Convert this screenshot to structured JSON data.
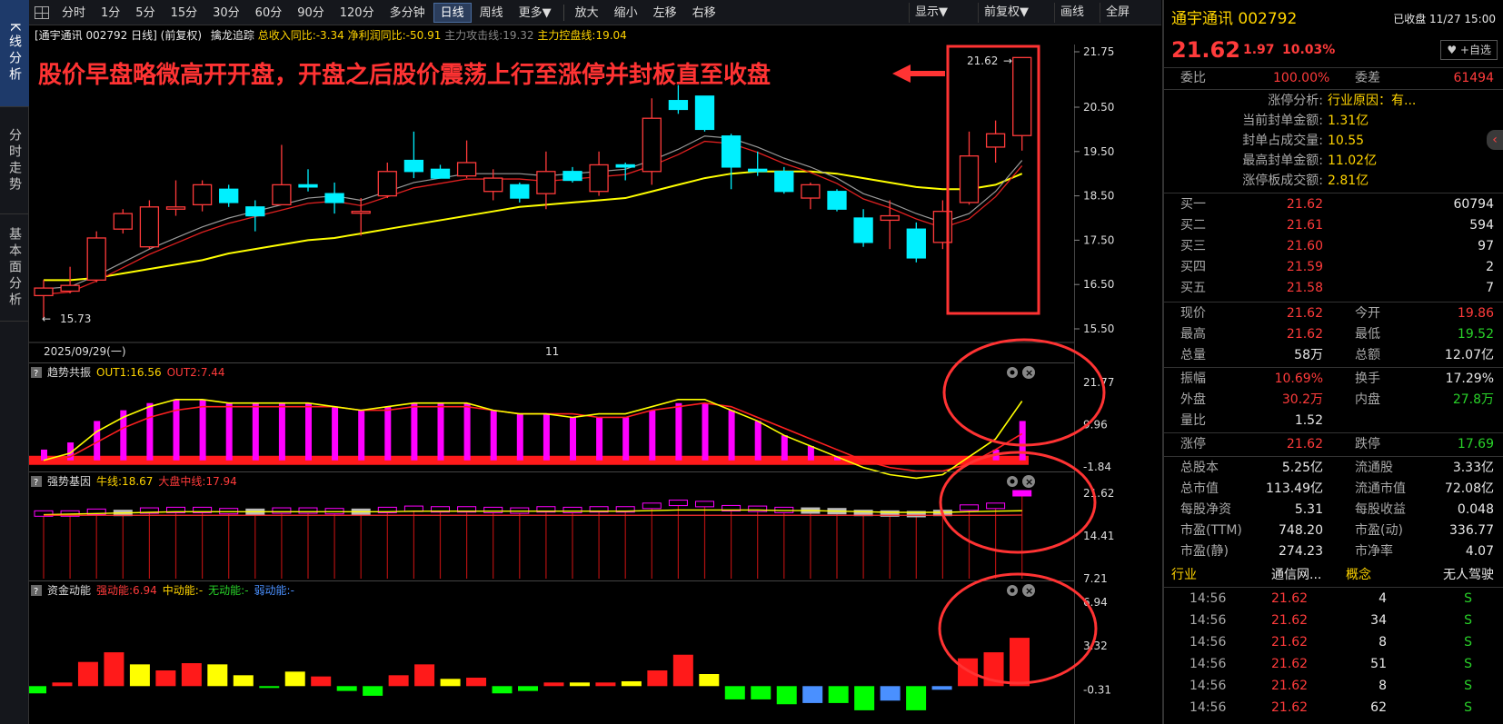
{
  "rail": {
    "tabs": [
      {
        "label": "K线分析",
        "active": true
      },
      {
        "label": "分时走势",
        "active": false
      },
      {
        "label": "基本面分析",
        "active": false
      }
    ]
  },
  "toolbar": {
    "periods": [
      "分时",
      "1分",
      "5分",
      "15分",
      "30分",
      "60分",
      "90分",
      "120分",
      "多分钟",
      "日线",
      "周线",
      "更多▼"
    ],
    "active_period": "日线",
    "actions": [
      "放大",
      "缩小",
      "左移",
      "右移"
    ],
    "right": [
      "显示▼",
      "前复权▼",
      "画线",
      "全屏"
    ]
  },
  "infobar": {
    "stock": "[通宇通讯 002792 日线]",
    "adjust": "(前复权)",
    "indicator": "擒龙追踪",
    "rev": "总收入同比:-3.34",
    "profit": "净利润同比:-50.91",
    "attack": "主力攻击线:19.32",
    "control": "主力控盘线:19.04"
  },
  "annotation": "股价早盘略微高开开盘，开盘之后股价震荡上行至涨停并封板直至收盘",
  "main_chart": {
    "price_axis": [
      "21.75",
      "20.50",
      "19.50",
      "18.50",
      "17.50",
      "16.50",
      "15.50"
    ],
    "date_left": "2025/09/29(一)",
    "date_mid": "11",
    "low_label": "15.73",
    "high_label": "21.62"
  },
  "panel1": {
    "name": "趋势共振",
    "out1": "OUT1:16.56",
    "out2": "OUT2:7.44",
    "axis": [
      "21.77",
      "9.96",
      "-1.84"
    ]
  },
  "panel2": {
    "name": "强势基因",
    "bull": "牛线:18.67",
    "market": "大盘中线:17.94",
    "axis": [
      "21.62",
      "14.41",
      "7.21"
    ]
  },
  "panel3": {
    "name": "资金动能",
    "strong": "强动能:6.94",
    "mid": "中动能:-",
    "none": "无动能:-",
    "weak": "弱动能:-",
    "axis": [
      "6.94",
      "3.32",
      "-0.31"
    ]
  },
  "chart_data": [
    {
      "type": "candlestick",
      "title": "通宇通讯 002792 日线",
      "candles": [
        {
          "o": 16.25,
          "c": 16.42,
          "h": 16.6,
          "l": 15.73
        },
        {
          "o": 16.35,
          "c": 16.48,
          "h": 16.9,
          "l": 16.3
        },
        {
          "o": 16.6,
          "c": 17.55,
          "h": 17.7,
          "l": 16.55
        },
        {
          "o": 17.75,
          "c": 18.1,
          "h": 18.2,
          "l": 17.65
        },
        {
          "o": 17.35,
          "c": 18.25,
          "h": 18.4,
          "l": 17.3
        },
        {
          "o": 18.2,
          "c": 18.25,
          "h": 18.85,
          "l": 18.05
        },
        {
          "o": 18.3,
          "c": 18.75,
          "h": 18.85,
          "l": 18.15
        },
        {
          "o": 18.65,
          "c": 18.35,
          "h": 18.75,
          "l": 18.25
        },
        {
          "o": 18.25,
          "c": 18.05,
          "h": 18.4,
          "l": 17.7
        },
        {
          "o": 18.3,
          "c": 18.75,
          "h": 19.65,
          "l": 18.3
        },
        {
          "o": 18.75,
          "c": 18.7,
          "h": 19.1,
          "l": 18.6
        },
        {
          "o": 18.55,
          "c": 18.35,
          "h": 18.8,
          "l": 18.1
        },
        {
          "o": 18.15,
          "c": 18.15,
          "h": 18.45,
          "l": 17.6
        },
        {
          "o": 18.5,
          "c": 19.05,
          "h": 19.25,
          "l": 18.45
        },
        {
          "o": 19.3,
          "c": 19.05,
          "h": 19.95,
          "l": 18.9
        },
        {
          "o": 19.1,
          "c": 18.9,
          "h": 19.2,
          "l": 18.9
        },
        {
          "o": 18.95,
          "c": 19.25,
          "h": 19.75,
          "l": 18.9
        },
        {
          "o": 18.6,
          "c": 18.9,
          "h": 19.1,
          "l": 18.4
        },
        {
          "o": 18.75,
          "c": 18.45,
          "h": 18.8,
          "l": 18.35
        },
        {
          "o": 18.55,
          "c": 19.05,
          "h": 19.5,
          "l": 18.2
        },
        {
          "o": 19.05,
          "c": 18.85,
          "h": 19.15,
          "l": 18.8
        },
        {
          "o": 18.6,
          "c": 19.2,
          "h": 19.5,
          "l": 18.5
        },
        {
          "o": 19.2,
          "c": 19.15,
          "h": 19.25,
          "l": 18.85
        },
        {
          "o": 19.05,
          "c": 20.25,
          "h": 20.7,
          "l": 18.75
        },
        {
          "o": 20.65,
          "c": 20.45,
          "h": 21.0,
          "l": 20.35
        },
        {
          "o": 20.75,
          "c": 20.0,
          "h": 20.75,
          "l": 19.95
        },
        {
          "o": 19.85,
          "c": 19.15,
          "h": 19.9,
          "l": 18.65
        },
        {
          "o": 19.1,
          "c": 19.05,
          "h": 19.5,
          "l": 18.95
        },
        {
          "o": 19.05,
          "c": 18.6,
          "h": 19.15,
          "l": 18.55
        },
        {
          "o": 18.45,
          "c": 18.75,
          "h": 18.8,
          "l": 18.2
        },
        {
          "o": 18.6,
          "c": 18.2,
          "h": 18.65,
          "l": 18.15
        },
        {
          "o": 18.0,
          "c": 17.45,
          "h": 18.2,
          "l": 17.35
        },
        {
          "o": 17.95,
          "c": 18.05,
          "h": 18.4,
          "l": 17.3
        },
        {
          "o": 17.75,
          "c": 17.1,
          "h": 17.9,
          "l": 17.0
        },
        {
          "o": 17.45,
          "c": 18.15,
          "h": 18.4,
          "l": 17.3
        },
        {
          "o": 18.35,
          "c": 19.4,
          "h": 19.95,
          "l": 18.3
        },
        {
          "o": 19.6,
          "c": 19.9,
          "h": 20.2,
          "l": 19.25
        },
        {
          "o": 19.86,
          "c": 21.62,
          "h": 21.62,
          "l": 19.52
        }
      ],
      "ma_white": [
        16.4,
        16.45,
        16.7,
        17.0,
        17.3,
        17.55,
        17.8,
        18.0,
        18.15,
        18.3,
        18.45,
        18.5,
        18.4,
        18.6,
        18.8,
        18.9,
        19.0,
        19.0,
        19.0,
        18.95,
        19.0,
        19.05,
        19.1,
        19.3,
        19.55,
        19.85,
        19.8,
        19.6,
        19.35,
        19.15,
        18.9,
        18.55,
        18.35,
        18.1,
        17.9,
        18.1,
        18.6,
        19.3
      ],
      "ma_yellow": [
        16.6,
        16.6,
        16.65,
        16.75,
        16.85,
        16.95,
        17.05,
        17.2,
        17.3,
        17.4,
        17.5,
        17.55,
        17.65,
        17.75,
        17.85,
        17.95,
        18.05,
        18.15,
        18.25,
        18.3,
        18.35,
        18.4,
        18.45,
        18.6,
        18.75,
        18.9,
        19.0,
        19.05,
        19.05,
        19.05,
        19.0,
        18.9,
        18.8,
        18.7,
        18.65,
        18.65,
        18.75,
        19.0
      ],
      "ylim": [
        15.5,
        21.75
      ]
    },
    {
      "type": "bar",
      "title": "趋势共振",
      "values": [
        3,
        5,
        11,
        14,
        16,
        17,
        17,
        16,
        16,
        16,
        16,
        15,
        14,
        15,
        16,
        16,
        16,
        14,
        13,
        13,
        12,
        12,
        12,
        14,
        16,
        16,
        14,
        11,
        7,
        4,
        1,
        -2,
        -3,
        -4,
        -3,
        0,
        3,
        11
      ],
      "series": [
        {
          "name": "OUT1",
          "values": [
            0,
            2,
            8,
            12,
            15,
            17,
            17,
            16,
            16,
            16,
            16,
            15,
            14,
            15,
            16,
            16,
            16,
            14,
            13,
            13,
            12,
            13,
            13,
            15,
            17,
            17,
            14,
            11,
            7,
            4,
            1,
            -2,
            -4,
            -5,
            -4,
            1,
            6,
            16.56
          ]
        },
        {
          "name": "OUT2",
          "values": [
            0,
            1,
            5,
            9,
            12,
            14,
            15,
            15,
            15,
            15,
            15,
            15,
            14,
            14,
            15,
            15,
            15,
            14,
            13,
            13,
            13,
            12,
            12,
            14,
            15,
            16,
            15,
            12,
            9,
            6,
            3,
            0,
            -2,
            -3,
            -3,
            -1,
            3,
            7.44
          ]
        }
      ],
      "ylim": [
        -1.84,
        21.77
      ]
    },
    {
      "type": "bar",
      "title": "强势基因",
      "values": [
        18.2,
        18.2,
        18.5,
        18.3,
        18.7,
        18.8,
        18.8,
        18.6,
        18.5,
        18.7,
        18.7,
        18.6,
        18.5,
        18.8,
        19.0,
        18.9,
        18.9,
        18.8,
        18.7,
        18.9,
        18.8,
        18.9,
        18.9,
        19.5,
        20.0,
        19.8,
        19.1,
        19.0,
        18.8,
        18.7,
        18.6,
        18.3,
        18.2,
        18.1,
        18.3,
        19.2,
        19.5,
        21.62
      ],
      "series": [
        {
          "name": "牛线",
          "values": [
            18.0,
            18.1,
            18.2,
            18.3,
            18.4,
            18.5,
            18.5,
            18.5,
            18.5,
            18.5,
            18.5,
            18.5,
            18.5,
            18.5,
            18.6,
            18.6,
            18.6,
            18.6,
            18.6,
            18.6,
            18.6,
            18.6,
            18.6,
            18.7,
            18.8,
            18.8,
            18.8,
            18.8,
            18.7,
            18.7,
            18.6,
            18.5,
            18.4,
            18.4,
            18.4,
            18.5,
            18.6,
            18.67
          ]
        },
        {
          "name": "大盘中线",
          "values": [
            17.9,
            17.9,
            17.9,
            17.9,
            17.9,
            17.9,
            17.9,
            17.9,
            17.9,
            17.9,
            17.9,
            17.9,
            17.9,
            17.9,
            17.9,
            17.9,
            17.9,
            17.9,
            17.9,
            17.9,
            17.9,
            17.9,
            17.9,
            17.9,
            17.9,
            17.9,
            17.9,
            17.9,
            17.9,
            17.9,
            17.9,
            17.9,
            17.9,
            17.9,
            17.9,
            17.9,
            17.9,
            17.94
          ]
        }
      ],
      "ylim": [
        7.21,
        21.62
      ]
    },
    {
      "type": "bar",
      "title": "资金动能",
      "values": [
        -0.6,
        0.3,
        2.0,
        2.8,
        1.8,
        1.3,
        1.9,
        1.8,
        0.9,
        -0.1,
        1.2,
        0.8,
        -0.4,
        -0.8,
        0.9,
        1.8,
        0.6,
        0.7,
        -0.6,
        -0.4,
        0.3,
        0.3,
        0.3,
        0.4,
        1.3,
        2.6,
        1.0,
        -1.1,
        -1.1,
        -1.5,
        -1.4,
        -1.4,
        -2.0,
        -1.2,
        -2.0,
        -0.3,
        2.3,
        2.8,
        4.0
      ],
      "colors": [
        "g",
        "r",
        "r",
        "r",
        "y",
        "r",
        "r",
        "y",
        "y",
        "g",
        "y",
        "r",
        "g",
        "g",
        "r",
        "r",
        "y",
        "r",
        "g",
        "g",
        "r",
        "y",
        "r",
        "y",
        "r",
        "r",
        "y",
        "g",
        "g",
        "g",
        "b",
        "g",
        "g",
        "b",
        "g",
        "b",
        "r",
        "r",
        "r"
      ],
      "ylim": [
        -0.31,
        6.94
      ]
    }
  ],
  "rp": {
    "name": "通宇通讯 002792",
    "status": "已收盘 11/27 15:00",
    "price": "21.62",
    "change": "1.97",
    "pct": "10.03%",
    "follow": "♥ +自选",
    "weibi_label": "委比",
    "weibi": "100.00%",
    "weicha_label": "委差",
    "weicha": "61494",
    "lu": [
      {
        "k": "涨停分析:",
        "v": "行业原因：有..."
      },
      {
        "k": "当前封单金额:",
        "v": "1.31亿"
      },
      {
        "k": "封单占成交量:",
        "v": "10.55"
      },
      {
        "k": "最高封单金额:",
        "v": "11.02亿"
      },
      {
        "k": "涨停板成交额:",
        "v": "2.81亿"
      }
    ],
    "bids": [
      {
        "k": "买一",
        "p": "21.62",
        "v": "60794"
      },
      {
        "k": "买二",
        "p": "21.61",
        "v": "594"
      },
      {
        "k": "买三",
        "p": "21.60",
        "v": "97"
      },
      {
        "k": "买四",
        "p": "21.59",
        "v": "2"
      },
      {
        "k": "买五",
        "p": "21.58",
        "v": "7"
      }
    ],
    "quote": [
      {
        "k1": "现价",
        "v1": "21.62",
        "c1": "red",
        "k2": "今开",
        "v2": "19.86",
        "c2": "red"
      },
      {
        "k1": "最高",
        "v1": "21.62",
        "c1": "red",
        "k2": "最低",
        "v2": "19.52",
        "c2": "green"
      },
      {
        "k1": "总量",
        "v1": "58万",
        "c1": "white",
        "k2": "总额",
        "v2": "12.07亿",
        "c2": "white"
      }
    ],
    "quote2": [
      {
        "k1": "振幅",
        "v1": "10.69%",
        "c1": "red",
        "k2": "换手",
        "v2": "17.29%",
        "c2": "white"
      },
      {
        "k1": "外盘",
        "v1": "30.2万",
        "c1": "red",
        "k2": "内盘",
        "v2": "27.8万",
        "c2": "green"
      },
      {
        "k1": "量比",
        "v1": "1.52",
        "c1": "white",
        "k2": "",
        "v2": "",
        "c2": "white"
      }
    ],
    "limits": {
      "k1": "涨停",
      "v1": "21.62",
      "k2": "跌停",
      "v2": "17.69"
    },
    "fund": [
      {
        "k1": "总股本",
        "v1": "5.25亿",
        "k2": "流通股",
        "v2": "3.33亿"
      },
      {
        "k1": "总市值",
        "v1": "113.49亿",
        "k2": "流通市值",
        "v2": "72.08亿"
      },
      {
        "k1": "每股净资",
        "v1": "5.31",
        "k2": "每股收益",
        "v2": "0.048"
      },
      {
        "k1": "市盈(TTM)",
        "v1": "748.20",
        "k2": "市盈(动)",
        "v2": "336.77"
      },
      {
        "k1": "市盈(静)",
        "v1": "274.23",
        "k2": "市净率",
        "v2": "4.07"
      }
    ],
    "industry": {
      "k1": "行业",
      "v1": "通信网...",
      "k2": "概念",
      "v2": "无人驾驶"
    },
    "ticks": [
      {
        "t": "14:56",
        "p": "21.62",
        "v": "4",
        "s": "S"
      },
      {
        "t": "14:56",
        "p": "21.62",
        "v": "34",
        "s": "S"
      },
      {
        "t": "14:56",
        "p": "21.62",
        "v": "8",
        "s": "S"
      },
      {
        "t": "14:56",
        "p": "21.62",
        "v": "51",
        "s": "S"
      },
      {
        "t": "14:56",
        "p": "21.62",
        "v": "8",
        "s": "S"
      },
      {
        "t": "14:56",
        "p": "21.62",
        "v": "62",
        "s": "S"
      }
    ]
  },
  "colors": {
    "up": "#ff3b3b",
    "down": "#00f0ff",
    "ma_yellow": "#ffff00",
    "annot": "#ff3333",
    "bg": "#000000"
  }
}
